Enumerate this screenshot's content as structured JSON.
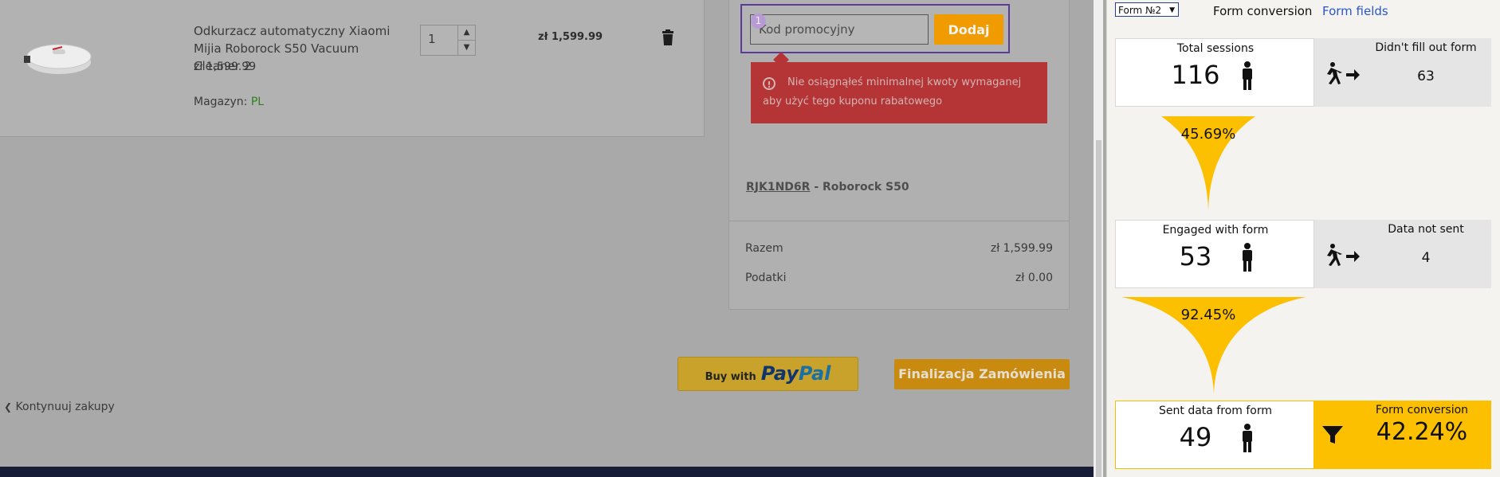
{
  "cart": {
    "product_name": "Odkurzacz automatyczny Xiaomi Mijia Roborock S50 Vacuum Cleaner 2",
    "unit_price": "zł 1,599.99",
    "warehouse_label": "Magazyn:",
    "warehouse_value": "PL",
    "quantity": "1",
    "row_total": "zł 1,599.99"
  },
  "promo": {
    "step_number": "1",
    "placeholder": "Kod promocyjny",
    "add_label": "Dodaj",
    "error_message": "Nie osiągnąłeś minimalnej kwoty wymaganej aby użyć tego kuponu rabatowego",
    "applied_code": "RJK1ND6R",
    "applied_desc": "- Roborock S50"
  },
  "summary": {
    "total_label": "Razem",
    "total_value": "zł 1,599.99",
    "tax_label": "Podatki",
    "tax_value": "zł 0.00"
  },
  "actions": {
    "paypal_prefix": "Buy with",
    "paypal_word1": "Pay",
    "paypal_word2": "Pal",
    "finalize_label": "Finalizacja Zamówienia",
    "continue_label": "Kontynuuj zakupy"
  },
  "analytics": {
    "form_select": "Form №2",
    "tab_conversion": "Form conversion",
    "tab_fields": "Form fields",
    "stages": [
      {
        "label": "Total sessions",
        "value": "116",
        "exit_label": "Didn't fill out form",
        "exit_value": "63"
      },
      {
        "label": "Engaged with form",
        "value": "53",
        "exit_label": "Data not sent",
        "exit_value": "4"
      },
      {
        "label": "Sent data from form",
        "value": "49"
      }
    ],
    "funnel_rates": [
      "45.69%",
      "92.45%"
    ],
    "conversion_label": "Form conversion",
    "conversion_value": "42.24%",
    "colors": {
      "accent": "#fcc000",
      "link": "#2b55c9",
      "error": "#b53435"
    }
  }
}
